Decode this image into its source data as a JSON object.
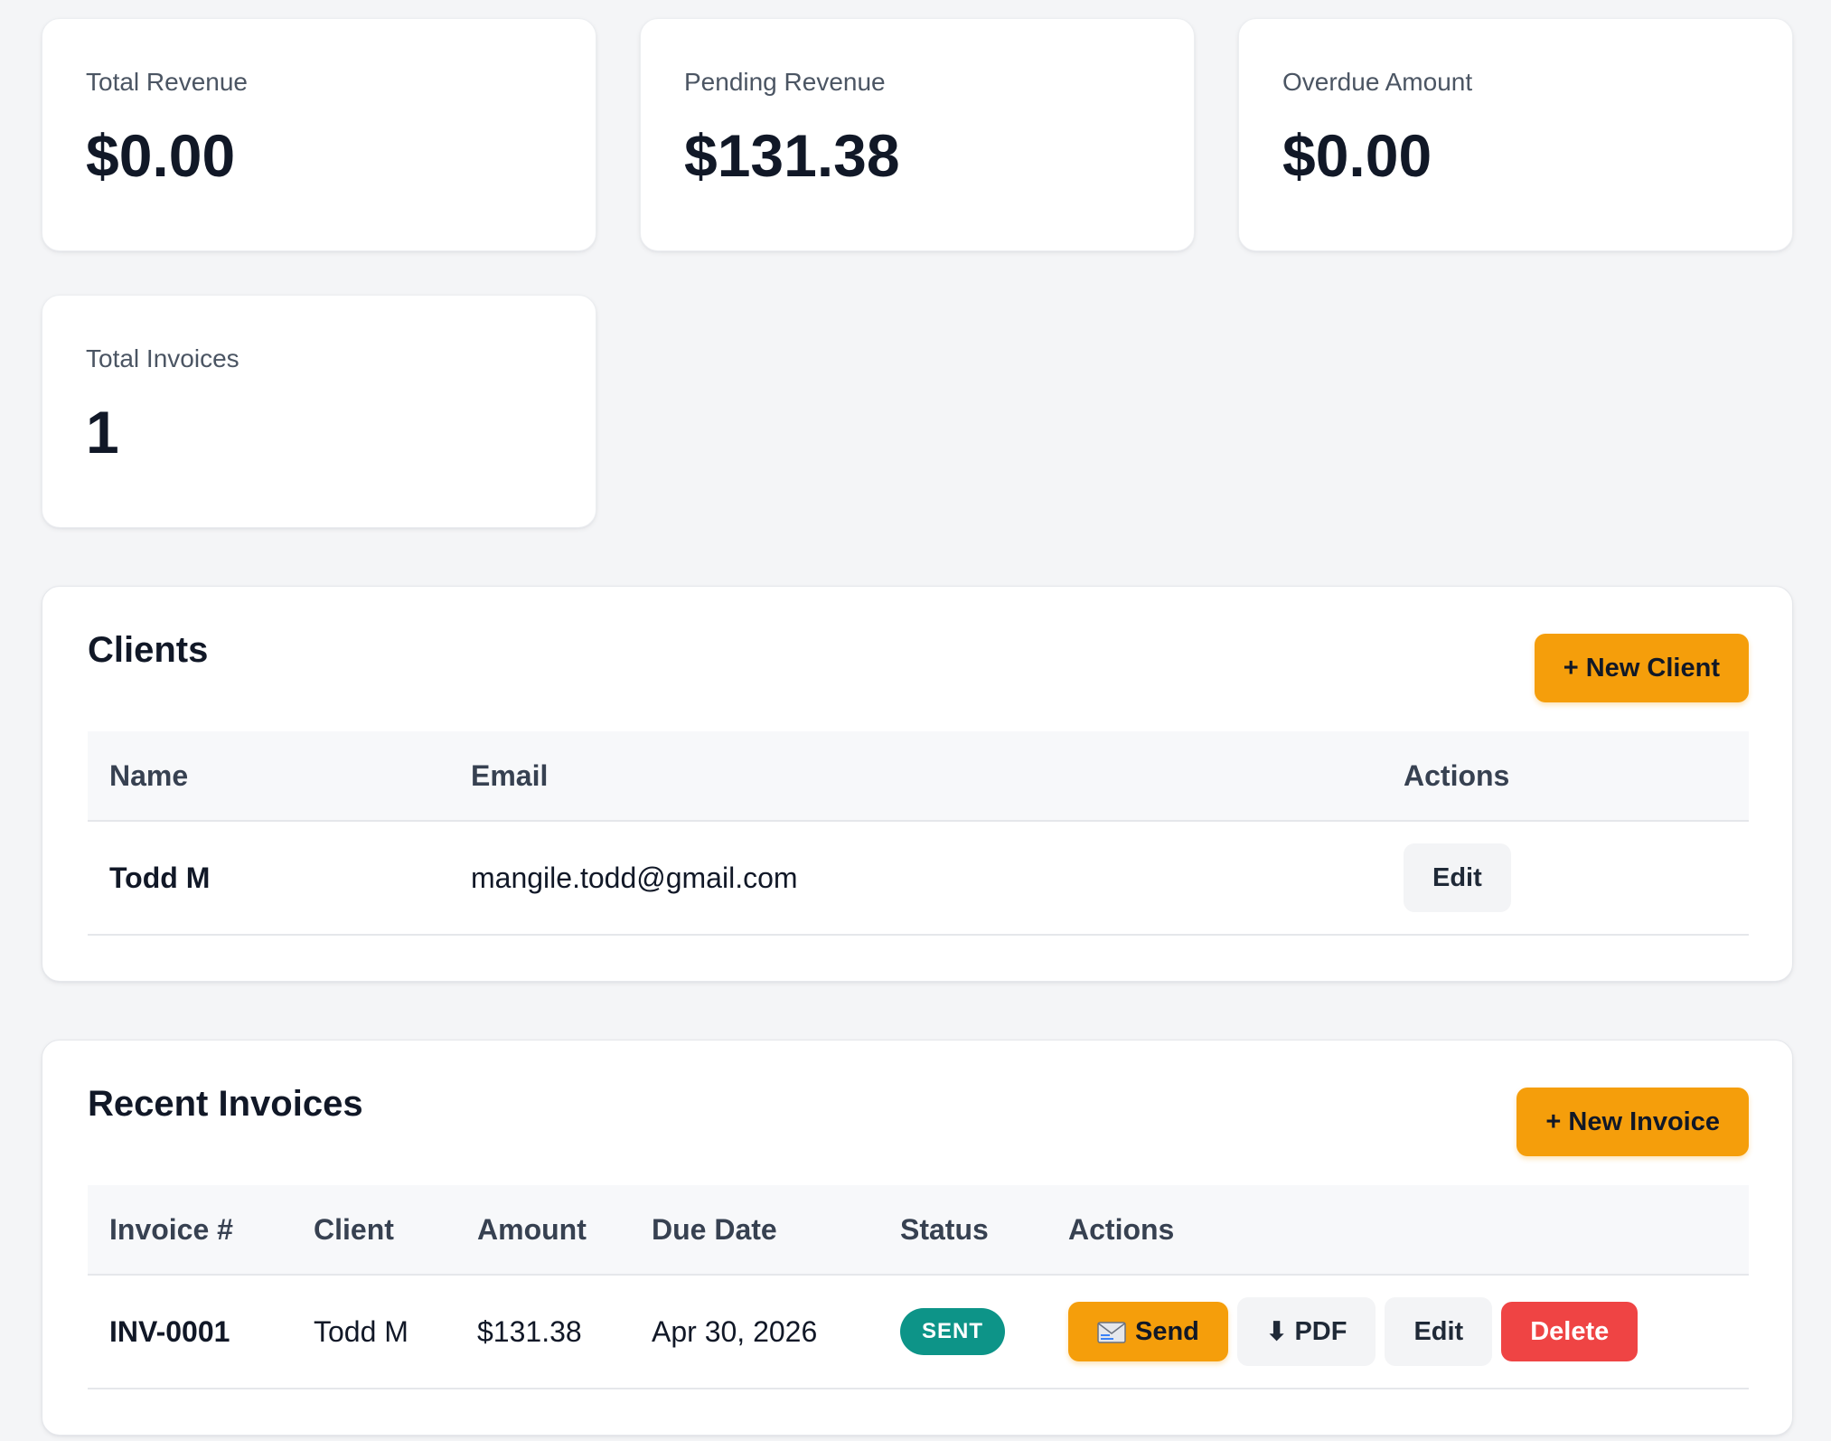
{
  "stats": [
    {
      "label": "Total Revenue",
      "value": "$0.00"
    },
    {
      "label": "Pending Revenue",
      "value": "$131.38"
    },
    {
      "label": "Overdue Amount",
      "value": "$0.00"
    },
    {
      "label": "Total Invoices",
      "value": "1"
    }
  ],
  "clients": {
    "title": "Clients",
    "new_button": "+ New Client",
    "columns": {
      "name": "Name",
      "email": "Email",
      "actions": "Actions"
    },
    "rows": [
      {
        "name": "Todd M",
        "email": "mangile.todd@gmail.com",
        "edit_label": "Edit"
      }
    ]
  },
  "invoices": {
    "title": "Recent Invoices",
    "new_button": "+ New Invoice",
    "columns": {
      "number": "Invoice #",
      "client": "Client",
      "amount": "Amount",
      "due_date": "Due Date",
      "status": "Status",
      "actions": "Actions"
    },
    "rows": [
      {
        "number": "INV-0001",
        "client": "Todd M",
        "amount": "$131.38",
        "due_date": "Apr 30, 2026",
        "status": "SENT",
        "send_label": "Send",
        "pdf_label": "PDF",
        "edit_label": "Edit",
        "delete_label": "Delete"
      }
    ]
  },
  "colors": {
    "accent": "#f59e0b",
    "danger": "#ef4444",
    "status_sent": "#0d9488",
    "background": "#f4f5f7"
  },
  "icons": {
    "send": "envelope-icon",
    "pdf": "arrow-down-icon"
  }
}
